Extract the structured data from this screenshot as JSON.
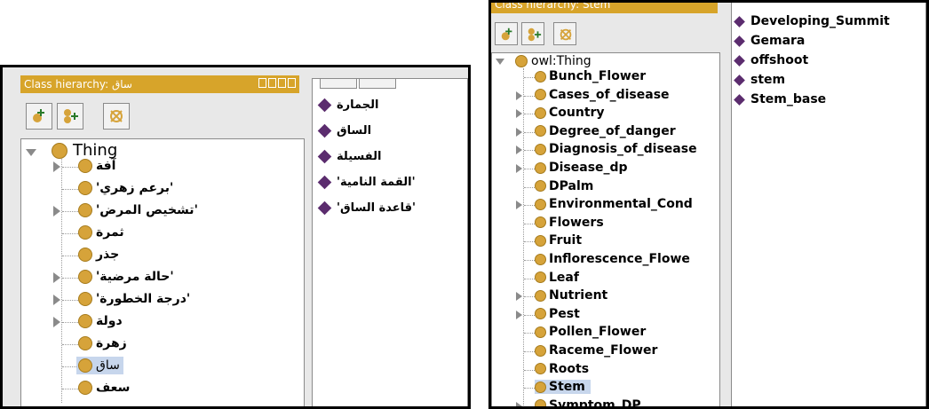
{
  "left_panel": {
    "title": "Class hierarchy: ساق",
    "root_label": "Thing",
    "classes": [
      "آفة",
      "'برعم زهري'",
      "'تشخيص المرض'",
      "ثمرة",
      "جذر",
      "'حالة مرضية'",
      "'درجة الخطورة'",
      "دولة",
      "زهرة",
      "ساق",
      "سعف"
    ],
    "selected": "ساق",
    "individuals": [
      "الجمارة",
      "الساق",
      "الفسيلة",
      "'القمة النامية'",
      "'قاعدة الساق'"
    ]
  },
  "right_panel": {
    "title": "Class hierarchy: Stem",
    "root_label": "owl:Thing",
    "classes": [
      "Bunch_Flower",
      "Cases_of_disease",
      "Country",
      "Degree_of_danger",
      "Diagnosis_of_disease",
      "Disease_dp",
      "DPalm",
      "Environmental_Cond",
      "Flowers",
      "Fruit",
      "Inflorescence_Flowe",
      "Leaf",
      "Nutrient",
      "Pest",
      "Pollen_Flower",
      "Raceme_Flower",
      "Roots",
      "Stem",
      "Symptom_DP"
    ],
    "selected": "Stem",
    "individuals": [
      "Developing_Summit",
      "Gemara",
      "offshoot",
      "stem",
      "Stem_base"
    ]
  },
  "icons": {
    "add_subclass": "add-subclass-icon",
    "add_sibling": "add-sibling-icon",
    "delete": "delete-class-icon"
  },
  "colors": {
    "titlebar": "#d7a42a",
    "class_dot": "#d6a33a",
    "individual_diamond": "#5b2c6e",
    "selection": "#c7d6ec"
  }
}
